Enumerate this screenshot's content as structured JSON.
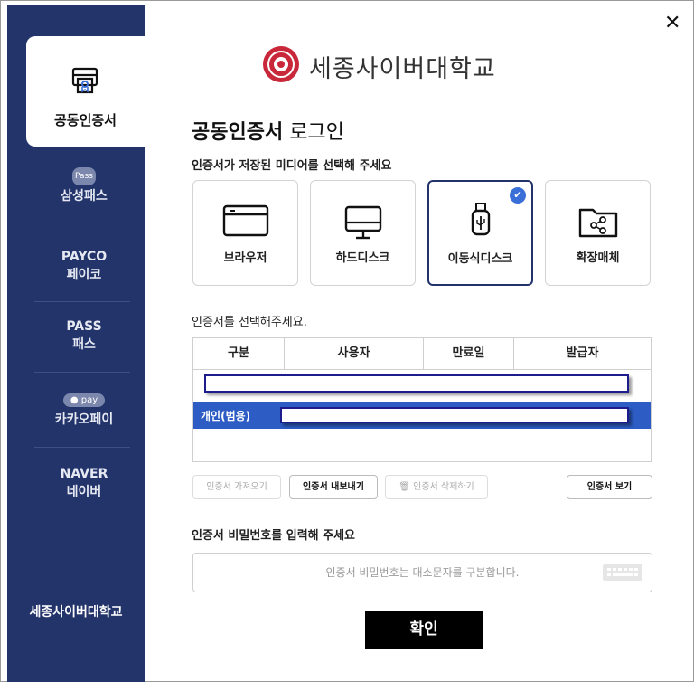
{
  "window": {
    "close_glyph": "✕"
  },
  "header": {
    "university": "세종사이버대학교"
  },
  "sidebar": {
    "active": {
      "label": "공동인증서",
      "icon": "certificate-icon"
    },
    "items": [
      {
        "badge": "Pass",
        "label": "삼성패스"
      },
      {
        "line1": "PAYCO",
        "line2": "페이코"
      },
      {
        "line1": "PASS",
        "line2": "패스"
      },
      {
        "badge": "● pay",
        "label": "카카오페이"
      },
      {
        "line1": "NAVER",
        "line2": "네이버"
      }
    ],
    "footer": "세종사이버대학교"
  },
  "login": {
    "title_bold": "공동인증서",
    "title_rest": " 로그인",
    "media_prompt": "인증서가 저장된 미디어를 선택해 주세요",
    "media": [
      {
        "label": "브라우저",
        "icon": "browser-icon"
      },
      {
        "label": "하드디스크",
        "icon": "monitor-icon"
      },
      {
        "label": "이동식디스크",
        "icon": "usb-icon",
        "selected": true
      },
      {
        "label": "확장매체",
        "icon": "share-folder-icon"
      }
    ],
    "cert_prompt": "인증서를 선택해주세요.",
    "table": {
      "headers": [
        "구분",
        "사용자",
        "만료일",
        "발급자"
      ],
      "selected_row_label": "개인(범용)"
    },
    "buttons": {
      "import": "인증서 가져오기",
      "export": "인증서 내보내기",
      "delete": "인증서 삭제하기",
      "view": "인증서 보기"
    },
    "password_prompt": "인증서 비밀번호를 입력해 주세요",
    "password_placeholder": "인증서 비밀번호는 대소문자를 구분합니다.",
    "confirm": "확인"
  },
  "colors": {
    "sidebar": "#23346b",
    "selected_row": "#2c5cc4",
    "check": "#3b6fd8"
  }
}
